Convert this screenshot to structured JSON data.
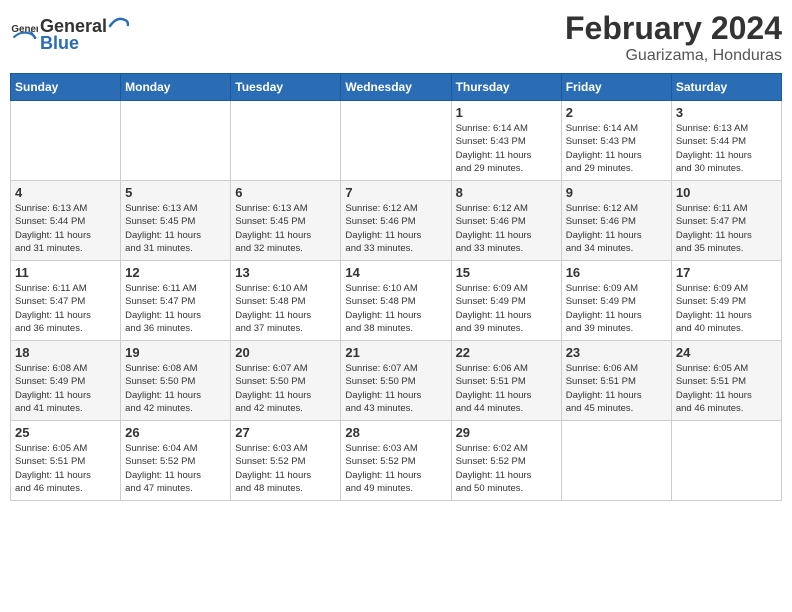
{
  "header": {
    "logo_general": "General",
    "logo_blue": "Blue",
    "main_title": "February 2024",
    "subtitle": "Guarizama, Honduras"
  },
  "columns": [
    "Sunday",
    "Monday",
    "Tuesday",
    "Wednesday",
    "Thursday",
    "Friday",
    "Saturday"
  ],
  "weeks": [
    [
      {
        "day": "",
        "info": ""
      },
      {
        "day": "",
        "info": ""
      },
      {
        "day": "",
        "info": ""
      },
      {
        "day": "",
        "info": ""
      },
      {
        "day": "1",
        "info": "Sunrise: 6:14 AM\nSunset: 5:43 PM\nDaylight: 11 hours\nand 29 minutes."
      },
      {
        "day": "2",
        "info": "Sunrise: 6:14 AM\nSunset: 5:43 PM\nDaylight: 11 hours\nand 29 minutes."
      },
      {
        "day": "3",
        "info": "Sunrise: 6:13 AM\nSunset: 5:44 PM\nDaylight: 11 hours\nand 30 minutes."
      }
    ],
    [
      {
        "day": "4",
        "info": "Sunrise: 6:13 AM\nSunset: 5:44 PM\nDaylight: 11 hours\nand 31 minutes."
      },
      {
        "day": "5",
        "info": "Sunrise: 6:13 AM\nSunset: 5:45 PM\nDaylight: 11 hours\nand 31 minutes."
      },
      {
        "day": "6",
        "info": "Sunrise: 6:13 AM\nSunset: 5:45 PM\nDaylight: 11 hours\nand 32 minutes."
      },
      {
        "day": "7",
        "info": "Sunrise: 6:12 AM\nSunset: 5:46 PM\nDaylight: 11 hours\nand 33 minutes."
      },
      {
        "day": "8",
        "info": "Sunrise: 6:12 AM\nSunset: 5:46 PM\nDaylight: 11 hours\nand 33 minutes."
      },
      {
        "day": "9",
        "info": "Sunrise: 6:12 AM\nSunset: 5:46 PM\nDaylight: 11 hours\nand 34 minutes."
      },
      {
        "day": "10",
        "info": "Sunrise: 6:11 AM\nSunset: 5:47 PM\nDaylight: 11 hours\nand 35 minutes."
      }
    ],
    [
      {
        "day": "11",
        "info": "Sunrise: 6:11 AM\nSunset: 5:47 PM\nDaylight: 11 hours\nand 36 minutes."
      },
      {
        "day": "12",
        "info": "Sunrise: 6:11 AM\nSunset: 5:47 PM\nDaylight: 11 hours\nand 36 minutes."
      },
      {
        "day": "13",
        "info": "Sunrise: 6:10 AM\nSunset: 5:48 PM\nDaylight: 11 hours\nand 37 minutes."
      },
      {
        "day": "14",
        "info": "Sunrise: 6:10 AM\nSunset: 5:48 PM\nDaylight: 11 hours\nand 38 minutes."
      },
      {
        "day": "15",
        "info": "Sunrise: 6:09 AM\nSunset: 5:49 PM\nDaylight: 11 hours\nand 39 minutes."
      },
      {
        "day": "16",
        "info": "Sunrise: 6:09 AM\nSunset: 5:49 PM\nDaylight: 11 hours\nand 39 minutes."
      },
      {
        "day": "17",
        "info": "Sunrise: 6:09 AM\nSunset: 5:49 PM\nDaylight: 11 hours\nand 40 minutes."
      }
    ],
    [
      {
        "day": "18",
        "info": "Sunrise: 6:08 AM\nSunset: 5:49 PM\nDaylight: 11 hours\nand 41 minutes."
      },
      {
        "day": "19",
        "info": "Sunrise: 6:08 AM\nSunset: 5:50 PM\nDaylight: 11 hours\nand 42 minutes."
      },
      {
        "day": "20",
        "info": "Sunrise: 6:07 AM\nSunset: 5:50 PM\nDaylight: 11 hours\nand 42 minutes."
      },
      {
        "day": "21",
        "info": "Sunrise: 6:07 AM\nSunset: 5:50 PM\nDaylight: 11 hours\nand 43 minutes."
      },
      {
        "day": "22",
        "info": "Sunrise: 6:06 AM\nSunset: 5:51 PM\nDaylight: 11 hours\nand 44 minutes."
      },
      {
        "day": "23",
        "info": "Sunrise: 6:06 AM\nSunset: 5:51 PM\nDaylight: 11 hours\nand 45 minutes."
      },
      {
        "day": "24",
        "info": "Sunrise: 6:05 AM\nSunset: 5:51 PM\nDaylight: 11 hours\nand 46 minutes."
      }
    ],
    [
      {
        "day": "25",
        "info": "Sunrise: 6:05 AM\nSunset: 5:51 PM\nDaylight: 11 hours\nand 46 minutes."
      },
      {
        "day": "26",
        "info": "Sunrise: 6:04 AM\nSunset: 5:52 PM\nDaylight: 11 hours\nand 47 minutes."
      },
      {
        "day": "27",
        "info": "Sunrise: 6:03 AM\nSunset: 5:52 PM\nDaylight: 11 hours\nand 48 minutes."
      },
      {
        "day": "28",
        "info": "Sunrise: 6:03 AM\nSunset: 5:52 PM\nDaylight: 11 hours\nand 49 minutes."
      },
      {
        "day": "29",
        "info": "Sunrise: 6:02 AM\nSunset: 5:52 PM\nDaylight: 11 hours\nand 50 minutes."
      },
      {
        "day": "",
        "info": ""
      },
      {
        "day": "",
        "info": ""
      }
    ]
  ]
}
